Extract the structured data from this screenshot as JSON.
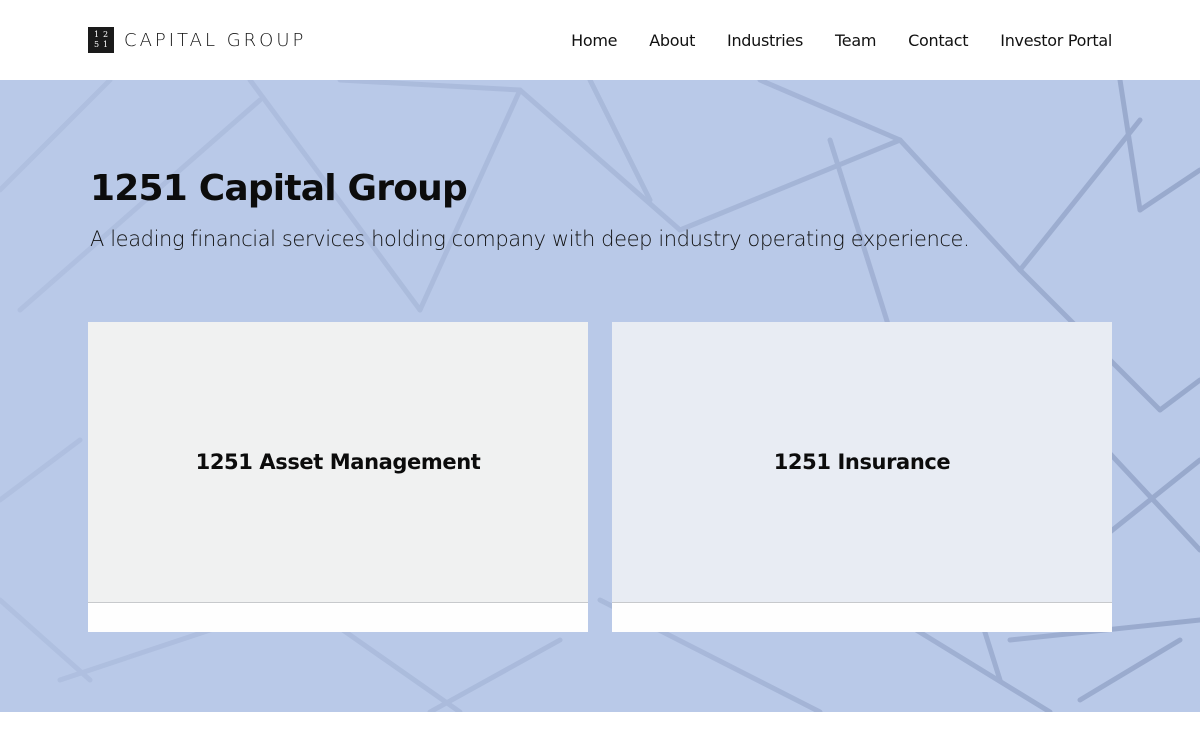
{
  "header": {
    "logo": {
      "mark_digits": [
        "1",
        "2",
        "5",
        "1"
      ],
      "text": "CAPITAL GROUP"
    },
    "nav": [
      {
        "label": "Home"
      },
      {
        "label": "About"
      },
      {
        "label": "Industries"
      },
      {
        "label": "Team"
      },
      {
        "label": "Contact"
      },
      {
        "label": "Investor Portal"
      }
    ]
  },
  "hero": {
    "title": "1251 Capital Group",
    "subtitle": "A leading financial services holding company with deep industry operating experience.",
    "background_color": "#b9c9e8"
  },
  "cards": [
    {
      "label": "1251 Asset Management"
    },
    {
      "label": "1251 Insurance"
    }
  ]
}
